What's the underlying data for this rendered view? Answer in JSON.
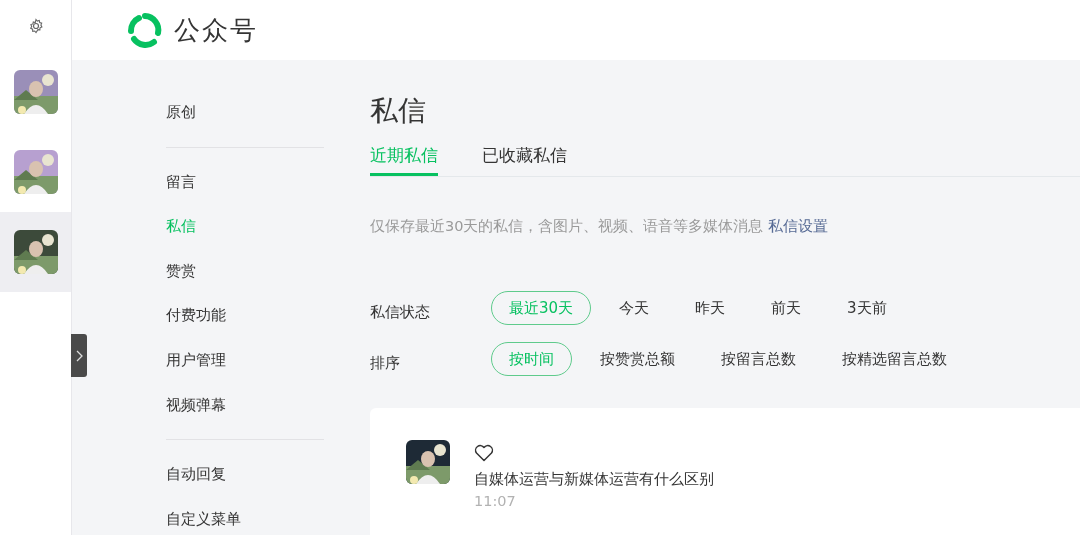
{
  "rail": {
    "accounts": [
      {
        "kind": "picture",
        "selected": false
      },
      {
        "kind": "picture",
        "selected": false
      },
      {
        "kind": "picture",
        "selected": true
      }
    ]
  },
  "header": {
    "brand": "公众号"
  },
  "menu": {
    "groups": [
      [
        {
          "label": "原创",
          "selected": false
        }
      ],
      [
        {
          "label": "留言",
          "selected": false
        },
        {
          "label": "私信",
          "selected": true
        },
        {
          "label": "赞赏",
          "selected": false
        },
        {
          "label": "付费功能",
          "selected": false
        },
        {
          "label": "用户管理",
          "selected": false
        },
        {
          "label": "视频弹幕",
          "selected": false
        }
      ],
      [
        {
          "label": "自动回复",
          "selected": false
        },
        {
          "label": "自定义菜单",
          "selected": false
        }
      ]
    ]
  },
  "page": {
    "title": "私信",
    "tabs": [
      {
        "label": "近期私信",
        "selected": true
      },
      {
        "label": "已收藏私信",
        "selected": false
      }
    ],
    "note": "仅保存最近30天的私信，含图片、视频、语音等多媒体消息",
    "note_link": "私信设置",
    "filters": [
      {
        "label": "私信状态",
        "options": [
          {
            "label": "最近30天",
            "selected": true
          },
          {
            "label": "今天",
            "selected": false
          },
          {
            "label": "昨天",
            "selected": false
          },
          {
            "label": "前天",
            "selected": false
          },
          {
            "label": "3天前",
            "selected": false
          }
        ]
      },
      {
        "label": "排序",
        "options": [
          {
            "label": "按时间",
            "selected": true
          },
          {
            "label": "按赞赏总额",
            "selected": false
          },
          {
            "label": "按留言总数",
            "selected": false
          },
          {
            "label": "按精选留言总数",
            "selected": false
          }
        ]
      }
    ],
    "messages": [
      {
        "favorited": false,
        "text": "自媒体运营与新媒体运营有什么区别",
        "time": "11:07"
      }
    ]
  }
}
